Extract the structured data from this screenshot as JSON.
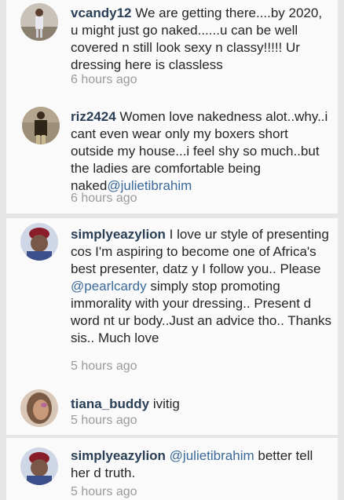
{
  "comments": [
    {
      "username": "vcandy12",
      "text": " We are getting there....by 2020, u might just go naked......u can be well covered n still look sexy n classy!!!!! Ur dressing here is classless",
      "time": "6 hours ago"
    },
    {
      "username": "riz2424",
      "text": " Women love nakedness alot..why..i cant even wear only my boxers short outside my house...i feel shy so much..but the ladies are comfortable being naked",
      "mention": "@julietibrahim",
      "time": "6 hours ago"
    },
    {
      "username": "simplyeazylion",
      "text_before": " I love ur style of presenting cos I'm aspiring to become one of Africa's best presenter, datz y I follow you.. Please ",
      "mention": "@pearlcardy",
      "text_after": "  simply stop promoting immorality with your dressing.. Present d word nt ur body..Just an advice tho.. Thanks sis.. Much love",
      "time": "5 hours ago"
    },
    {
      "username": "tiana_buddy",
      "text": " ivitig",
      "time": "5 hours ago"
    },
    {
      "username": "simplyeazylion",
      "mention": "@julietibrahim",
      "text_after": " better tell her d truth.",
      "time": "5 hours ago"
    }
  ]
}
